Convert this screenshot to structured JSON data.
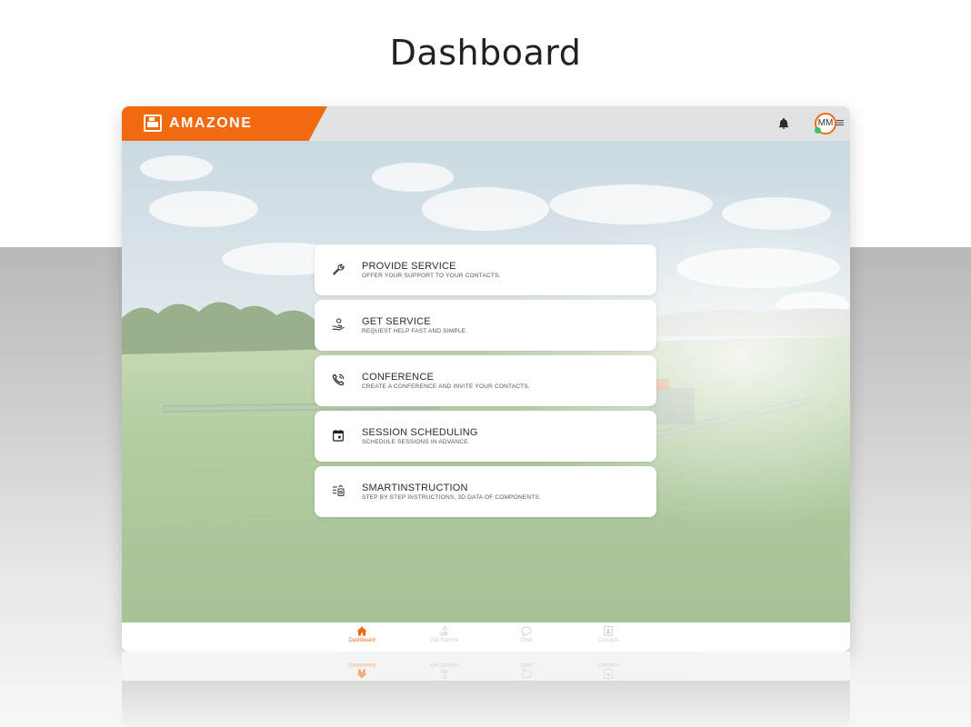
{
  "page": {
    "title": "Dashboard"
  },
  "header": {
    "brand": "AMAZONE",
    "avatar_initials": "MM",
    "colors": {
      "brand_orange": "#f26a10",
      "topbar_grey": "#e1e2e3",
      "status_online": "#3cc36a"
    }
  },
  "menu": {
    "items": [
      {
        "title": "PROVIDE SERVICE",
        "subtitle": "OFFER YOUR SUPPORT TO YOUR CONTACTS.",
        "icon": "wrench-icon"
      },
      {
        "title": "GET SERVICE",
        "subtitle": "REQUEST HELP FAST AND SIMPLE.",
        "icon": "helping-hand-icon"
      },
      {
        "title": "CONFERENCE",
        "subtitle": "CREATE A CONFERENCE AND INVITE YOUR CONTACTS.",
        "icon": "phone-call-icon"
      },
      {
        "title": "SESSION SCHEDULING",
        "subtitle": "SCHEDULE SESSIONS IN ADVANCE.",
        "icon": "calendar-icon"
      },
      {
        "title": "SMARTINSTRUCTION",
        "subtitle": "STEP BY STEP INSTRUCTIONS, 3D DATA OF COMPONENTS.",
        "icon": "instruction-list-icon"
      }
    ]
  },
  "bottom_nav": {
    "items": [
      {
        "label": "Dashboard",
        "icon": "home-icon",
        "active": true
      },
      {
        "label": "Get Service",
        "icon": "helping-hand-icon",
        "active": false
      },
      {
        "label": "Chat",
        "icon": "chat-bubble-icon",
        "active": false
      },
      {
        "label": "Contacts",
        "icon": "contacts-icon",
        "active": false
      }
    ]
  }
}
